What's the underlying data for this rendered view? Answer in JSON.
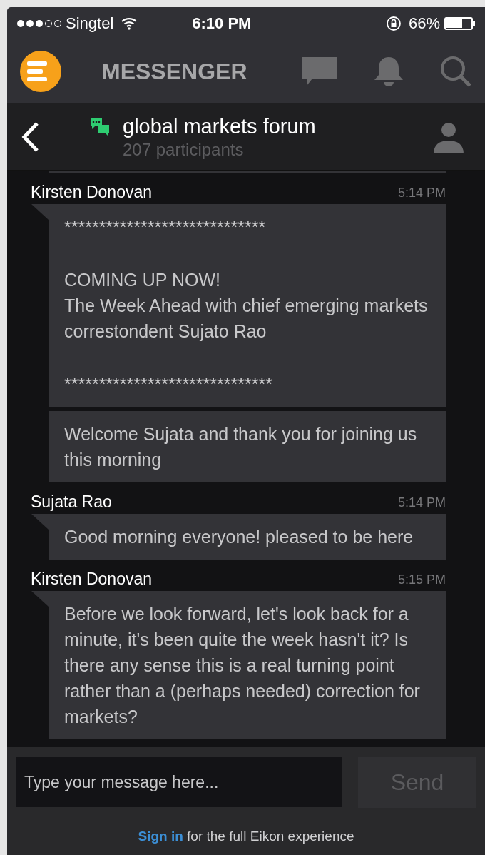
{
  "status_bar": {
    "carrier": "Singtel",
    "time": "6:10 PM",
    "battery": "66%"
  },
  "app_bar": {
    "title": "MESSENGER"
  },
  "chat_header": {
    "title": "global markets forum",
    "subtitle": "207 participants"
  },
  "groups": [
    {
      "sender": "Kirsten Donovan",
      "time": "5:14 PM",
      "bubbles": [
        {
          "paragraphs": [
            "*****************************",
            "COMING UP NOW!\nThe Week Ahead with chief emerging markets correstondent Sujato Rao",
            "******************************"
          ]
        },
        {
          "paragraphs": [
            "Welcome Sujata and thank you for joining us this morning"
          ]
        }
      ]
    },
    {
      "sender": "Sujata Rao",
      "time": "5:14 PM",
      "bubbles": [
        {
          "paragraphs": [
            "Good morning everyone! pleased to be here"
          ]
        }
      ]
    },
    {
      "sender": "Kirsten Donovan",
      "time": "5:15 PM",
      "bubbles": [
        {
          "paragraphs": [
            "Before we look forward, let's look back for a minute, it's been quite the week hasn't it? Is there any sense this is a real turning point rather than a (perhaps needed) correction for markets?"
          ]
        }
      ]
    }
  ],
  "composer": {
    "placeholder": "Type your message here...",
    "send": "Send",
    "send_disabled": true
  },
  "footer": {
    "link": "Sign in",
    "text": "for the full Eikon experience"
  }
}
